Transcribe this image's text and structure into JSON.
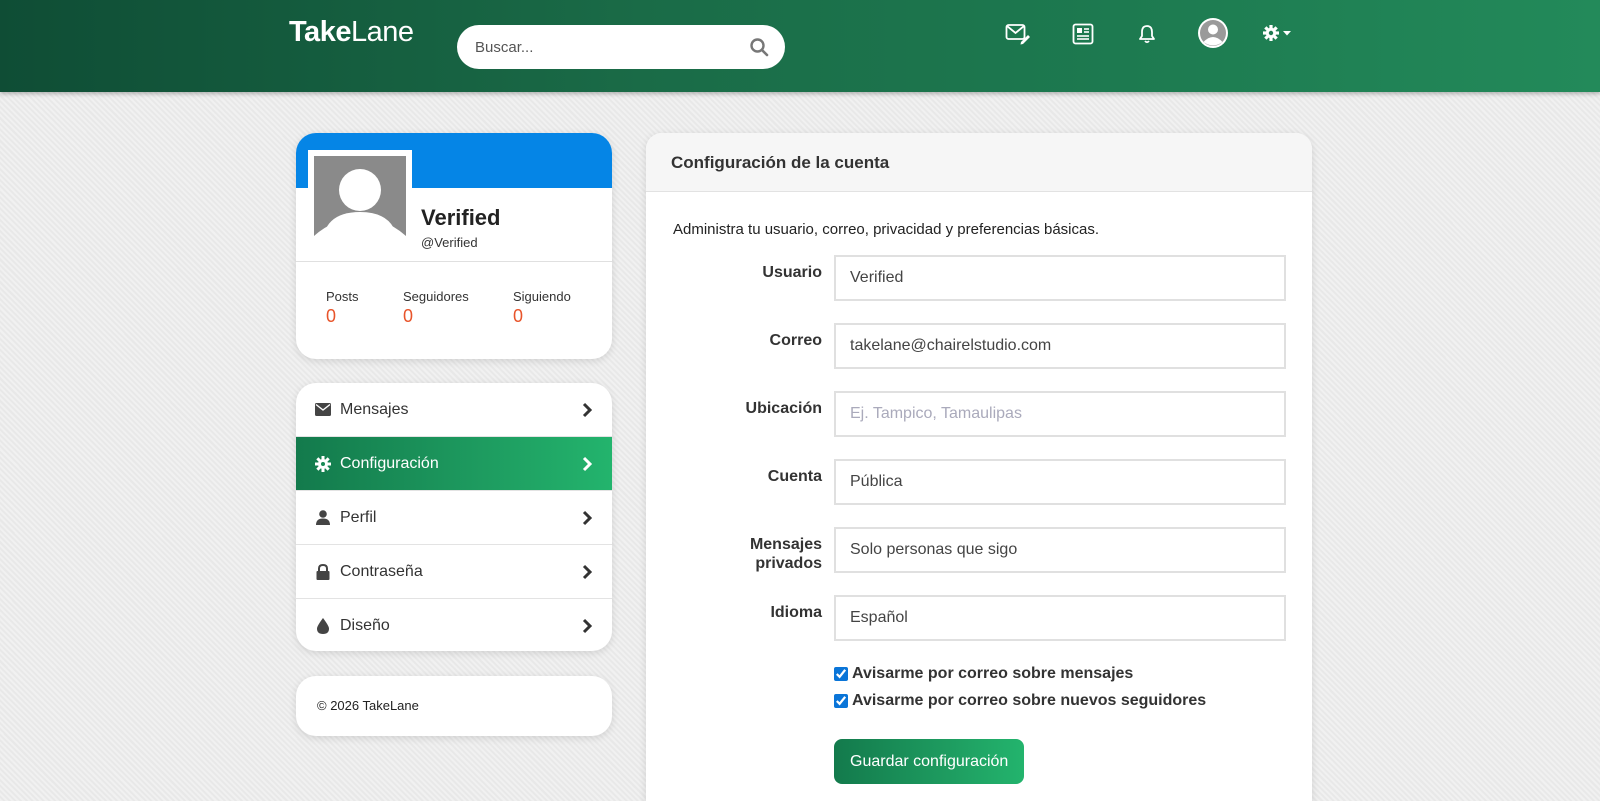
{
  "header": {
    "logo_bold": "Take",
    "logo_light": "Lane",
    "search_placeholder": "Buscar..."
  },
  "profile": {
    "name": "Verified",
    "handle": "@Verified",
    "stats": [
      {
        "label": "Posts",
        "value": "0"
      },
      {
        "label": "Seguidores",
        "value": "0"
      },
      {
        "label": "Siguiendo",
        "value": "0"
      }
    ]
  },
  "menu": {
    "items": [
      {
        "label": "Mensajes",
        "icon": "envelope-icon"
      },
      {
        "label": "Configuración",
        "icon": "gear-icon",
        "active": true
      },
      {
        "label": "Perfil",
        "icon": "user-icon"
      },
      {
        "label": "Contraseña",
        "icon": "lock-icon"
      },
      {
        "label": "Diseño",
        "icon": "drop-icon"
      }
    ]
  },
  "footer": {
    "copyright": "© 2026 TakeLane"
  },
  "settings": {
    "title": "Configuración de la cuenta",
    "description": "Administra tu usuario, correo, privacidad y preferencias básicas.",
    "fields": {
      "usuario": {
        "label": "Usuario",
        "value": "Verified"
      },
      "correo": {
        "label": "Correo",
        "value": "takelane@chairelstudio.com"
      },
      "ubicacion": {
        "label": "Ubicación",
        "value": "",
        "placeholder": "Ej. Tampico, Tamaulipas"
      },
      "cuenta": {
        "label": "Cuenta",
        "value": "Pública"
      },
      "mensajes": {
        "label_line1": "Mensajes",
        "label_line2": "privados",
        "value": "Solo personas que sigo"
      },
      "idioma": {
        "label": "Idioma",
        "value": "Español"
      }
    },
    "checks": {
      "mensajes": {
        "label": "Avisarme por correo sobre mensajes",
        "checked": true
      },
      "seguidores": {
        "label": "Avisarme por correo sobre nuevos seguidores",
        "checked": true
      }
    },
    "save_label": "Guardar configuración"
  },
  "colors": {
    "accent_green": "#1e9c60",
    "cover_blue": "#0585e6",
    "stat_orange": "#e8542a"
  }
}
